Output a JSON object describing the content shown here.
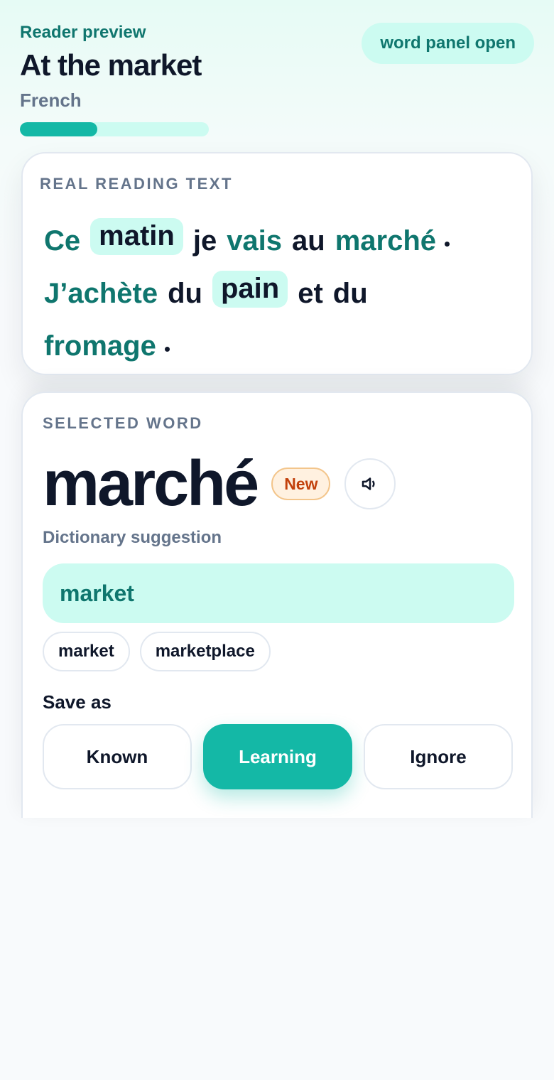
{
  "header": {
    "eyebrow": "Reader preview",
    "title": "At the market",
    "language": "French",
    "progress_fraction": 0.41,
    "status_pill": "word panel open"
  },
  "reading": {
    "label": "REAL READING TEXT",
    "lines": [
      [
        {
          "text": "Ce",
          "state": "learning"
        },
        {
          "text": "matin",
          "state": "new"
        },
        {
          "text": "je",
          "state": "known"
        },
        {
          "text": "vais",
          "state": "learning"
        },
        {
          "text": "au",
          "state": "known"
        },
        {
          "text": "marché",
          "state": "learning",
          "punct": true
        }
      ],
      [
        {
          "text": "J’achète",
          "state": "learning"
        },
        {
          "text": "du",
          "state": "known"
        },
        {
          "text": "pain",
          "state": "new"
        },
        {
          "text": "et",
          "state": "known"
        },
        {
          "text": "du",
          "state": "known"
        }
      ],
      [
        {
          "text": "fromage",
          "state": "learning",
          "punct": true
        }
      ]
    ]
  },
  "selected": {
    "label": "SELECTED WORD",
    "word": "marché",
    "badge": "New",
    "audio_icon": "speaker-icon",
    "dictionary_label": "Dictionary suggestion",
    "suggestion": "market",
    "alternatives": [
      "market",
      "marketplace"
    ],
    "save_label": "Save as",
    "save_options": [
      {
        "label": "Known",
        "active": false
      },
      {
        "label": "Learning",
        "active": true
      },
      {
        "label": "Ignore",
        "active": false
      }
    ]
  },
  "colors": {
    "accent": "#14b8a6",
    "accent_dark": "#0f766e",
    "highlight": "#ccfbf1",
    "badge_new": "#c2410c"
  }
}
